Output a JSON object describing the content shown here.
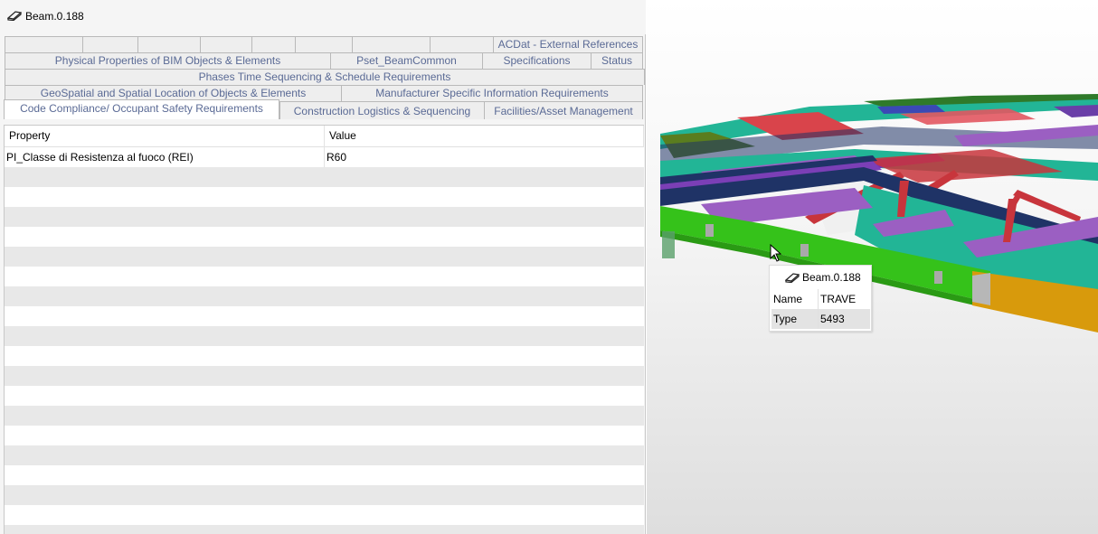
{
  "panel": {
    "title": "Beam.0.188",
    "title_icon": "beam-icon"
  },
  "tabs": {
    "row1": [
      "",
      "",
      "",
      "",
      "",
      "",
      "",
      "",
      "ACDat - External References"
    ],
    "row2": [
      "Physical Properties of BIM Objects & Elements",
      "Pset_BeamCommon",
      "Specifications",
      "Status"
    ],
    "row3": [
      "Phases Time Sequencing & Schedule Requirements"
    ],
    "row4": [
      "GeoSpatial and Spatial Location of Objects & Elements",
      "Manufacturer Specific Information Requirements"
    ],
    "row5": [
      "Code Compliance/ Occupant Safety Requirements",
      "Construction Logistics & Sequencing",
      "Facilities/Asset Management"
    ],
    "active": "Code Compliance/ Occupant Safety Requirements"
  },
  "table": {
    "columns": [
      "Property",
      "Value"
    ],
    "rows": [
      {
        "property": "PI_Classe di Resistenza al fuoco (REI)",
        "value": "R60"
      }
    ]
  },
  "tooltip": {
    "title": "Beam.0.188",
    "icon": "beam-icon",
    "rows": [
      {
        "key": "Name",
        "value": "TRAVE"
      },
      {
        "key": "Type",
        "value": "5493"
      }
    ]
  },
  "colors": {
    "tab_text": "#5a6a95",
    "row_stripe": "#e8e8e8",
    "beam_green": "#35c21a",
    "beam_teal": "#22b596",
    "beam_purple": "#9b5fc2",
    "beam_navy": "#1f3366",
    "beam_red": "#c8353c",
    "beam_orange": "#d89a0c"
  }
}
